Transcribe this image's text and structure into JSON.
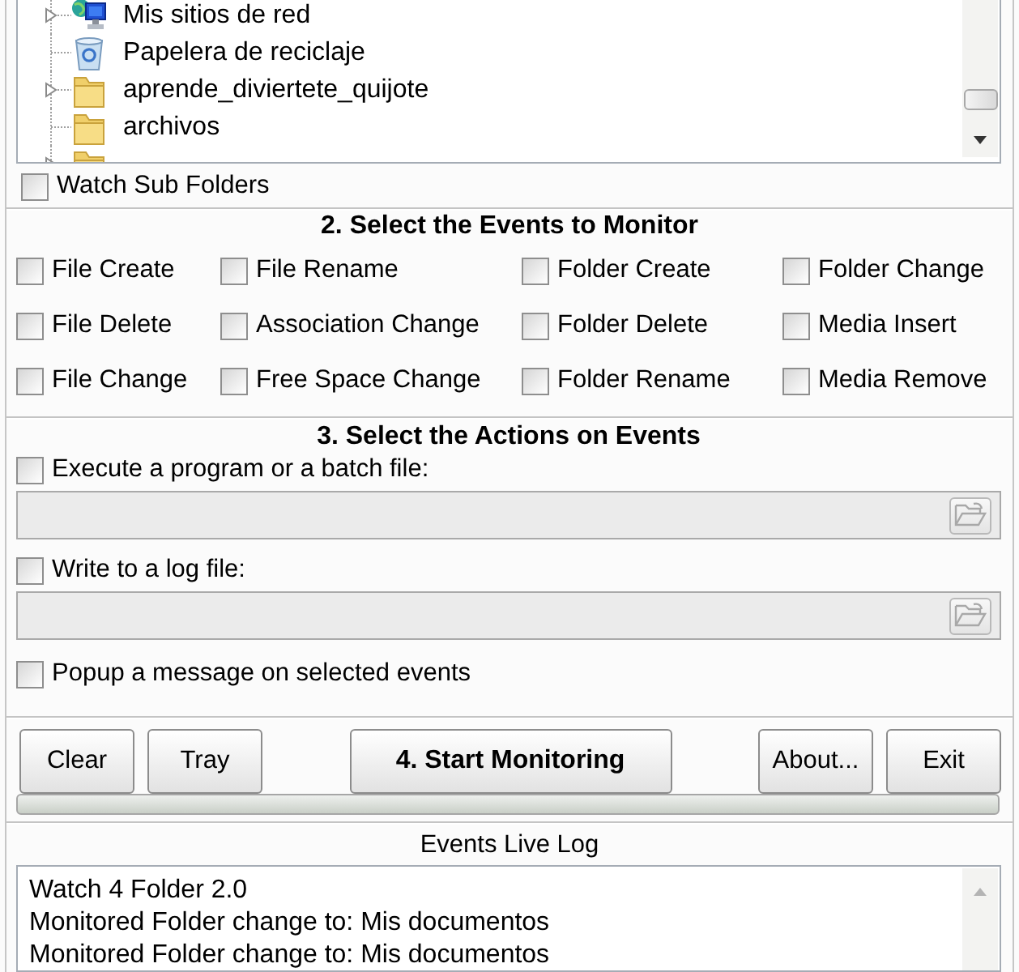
{
  "folder_tree": {
    "items": [
      {
        "kind": "network",
        "label": "Mis sitios de red",
        "expandable": true
      },
      {
        "kind": "recycle_bin",
        "label": "Papelera de reciclaje",
        "expandable": false
      },
      {
        "kind": "folder",
        "label": "aprende_diviertete_quijote",
        "expandable": true
      },
      {
        "kind": "folder",
        "label": "archivos",
        "expandable": false
      },
      {
        "kind": "folder",
        "expandable": true
      }
    ]
  },
  "watch_sub_folders": {
    "label": "Watch Sub Folders",
    "checked": false
  },
  "events_section": {
    "title": "2. Select the Events to Monitor",
    "events": [
      {
        "label": "File Create",
        "checked": false
      },
      {
        "label": "File Rename",
        "checked": false
      },
      {
        "label": "Folder Create",
        "checked": false
      },
      {
        "label": "Folder Change",
        "checked": false
      },
      {
        "label": "File Delete",
        "checked": false
      },
      {
        "label": "Association Change",
        "checked": false
      },
      {
        "label": "Folder Delete",
        "checked": false
      },
      {
        "label": "Media Insert",
        "checked": false
      },
      {
        "label": "File Change",
        "checked": false
      },
      {
        "label": "Free Space Change",
        "checked": false
      },
      {
        "label": "Folder Rename",
        "checked": false
      },
      {
        "label": "Media Remove",
        "checked": false
      }
    ]
  },
  "actions_section": {
    "title": "3. Select the Actions on Events",
    "actions": [
      {
        "kind": "file",
        "label": "Execute a program or a batch file:",
        "checked": false,
        "disabled": true
      },
      {
        "kind": "file",
        "label": "Write to a log file:",
        "checked": false,
        "disabled": true
      },
      {
        "kind": "plain",
        "label": "Popup a message on selected events",
        "checked": false
      }
    ]
  },
  "buttons": [
    {
      "kind": "normal",
      "label": "Clear"
    },
    {
      "kind": "normal",
      "label": "Tray"
    },
    {
      "kind": "primary",
      "label": "4. Start Monitoring"
    },
    {
      "kind": "normal",
      "label": "About..."
    },
    {
      "kind": "normal",
      "label": "Exit"
    }
  ],
  "progress": {
    "level": 0
  },
  "log": {
    "title": "Events Live Log",
    "lines": [
      "Watch 4 Folder 2.0",
      "Monitored Folder change to: Mis documentos",
      "Monitored Folder change to: Mis documentos"
    ]
  }
}
